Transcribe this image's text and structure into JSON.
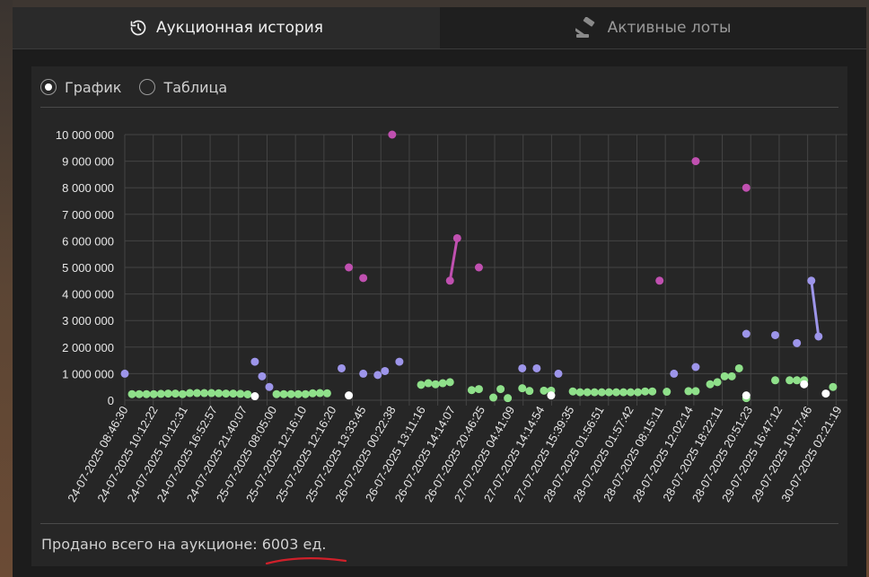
{
  "tabs": {
    "history_label": "Аукционная история",
    "active_lots_label": "Активные лоты"
  },
  "view_switch": {
    "chart_label": "График",
    "table_label": "Таблица",
    "selected": "График"
  },
  "footer": {
    "sold_total_prefix": "Продано всего на аукционе:",
    "sold_total_value": "6003 ед."
  },
  "colors": {
    "green": "#8fe08a",
    "blue": "#9d95ea",
    "magenta": "#c050b0",
    "white": "#ffffff",
    "annotation_red": "#d0202a"
  },
  "chart_data": {
    "type": "scatter",
    "ylim": [
      0,
      10000000
    ],
    "y_ticks": [
      "0",
      "1 000 000",
      "2 000 000",
      "3 000 000",
      "4 000 000",
      "5 000 000",
      "6 000 000",
      "7 000 000",
      "8 000 000",
      "9 000 000",
      "10 000 000"
    ],
    "x_tick_labels": [
      "24-07-2025 08:46:30",
      "24-07-2025 10:12:22",
      "24-07-2025 10:12:31",
      "24-07-2025 16:52:57",
      "24-07-2025 21:40:07",
      "25-07-2025 08:05:00",
      "25-07-2025 12:16:10",
      "25-07-2025 12:16:20",
      "25-07-2025 13:33:45",
      "26-07-2025 00:22:38",
      "26-07-2025 13:11:16",
      "26-07-2025 14:14:07",
      "26-07-2025 20:46:25",
      "27-07-2025 04:41:09",
      "27-07-2025 14:14:54",
      "27-07-2025 15:39:35",
      "28-07-2025 01:56:51",
      "28-07-2025 01:57:42",
      "28-07-2025 08:15:11",
      "28-07-2025 12:02:14",
      "28-07-2025 18:22:11",
      "28-07-2025 20:51:23",
      "29-07-2025 16:47:12",
      "29-07-2025 19:17:46",
      "30-07-2025 02:21:19"
    ],
    "x_range": [
      0,
      100
    ],
    "grid": true,
    "series": [
      {
        "color": "green",
        "points": [
          [
            1,
            230000
          ],
          [
            2,
            230000
          ],
          [
            3,
            230000
          ],
          [
            4,
            230000
          ],
          [
            5,
            240000
          ],
          [
            6,
            250000
          ],
          [
            7,
            250000
          ],
          [
            8,
            230000
          ],
          [
            9,
            270000
          ],
          [
            10,
            270000
          ],
          [
            11,
            270000
          ],
          [
            12,
            270000
          ],
          [
            13,
            260000
          ],
          [
            14,
            250000
          ],
          [
            15,
            250000
          ],
          [
            16,
            240000
          ],
          [
            17,
            220000
          ],
          [
            21,
            230000
          ],
          [
            22,
            230000
          ],
          [
            23,
            230000
          ],
          [
            24,
            230000
          ],
          [
            25,
            230000
          ],
          [
            26,
            260000
          ],
          [
            27,
            270000
          ],
          [
            28,
            260000
          ],
          [
            41,
            580000
          ],
          [
            42,
            640000
          ],
          [
            43,
            600000
          ],
          [
            44,
            640000
          ],
          [
            45,
            680000
          ],
          [
            48,
            380000
          ],
          [
            49,
            420000
          ],
          [
            51,
            100000
          ],
          [
            52,
            420000
          ],
          [
            53,
            80000
          ],
          [
            55,
            450000
          ],
          [
            56,
            350000
          ],
          [
            58,
            360000
          ],
          [
            59,
            360000
          ],
          [
            62,
            330000
          ],
          [
            63,
            300000
          ],
          [
            64,
            300000
          ],
          [
            65,
            300000
          ],
          [
            66,
            300000
          ],
          [
            67,
            300000
          ],
          [
            68,
            300000
          ],
          [
            69,
            300000
          ],
          [
            70,
            300000
          ],
          [
            71,
            300000
          ],
          [
            72,
            330000
          ],
          [
            73,
            330000
          ],
          [
            75,
            320000
          ],
          [
            78,
            340000
          ],
          [
            79,
            340000
          ],
          [
            81,
            600000
          ],
          [
            82,
            680000
          ],
          [
            83,
            900000
          ],
          [
            84,
            900000
          ],
          [
            85,
            1200000
          ],
          [
            86,
            80000
          ],
          [
            90,
            750000
          ],
          [
            92,
            750000
          ],
          [
            93,
            750000
          ],
          [
            94,
            750000
          ],
          [
            98,
            500000
          ]
        ],
        "lines": []
      },
      {
        "color": "blue",
        "points": [
          [
            0,
            1000000
          ],
          [
            18,
            1450000
          ],
          [
            19,
            900000
          ],
          [
            20,
            500000
          ],
          [
            30,
            1200000
          ],
          [
            33,
            1000000
          ],
          [
            35,
            950000
          ],
          [
            36,
            1100000
          ],
          [
            38,
            1450000
          ],
          [
            55,
            1200000
          ],
          [
            57,
            1200000
          ],
          [
            60,
            1000000
          ],
          [
            76,
            1000000
          ],
          [
            79,
            1250000
          ],
          [
            86,
            2500000
          ],
          [
            90,
            2450000
          ],
          [
            93,
            2150000
          ],
          [
            95,
            4500000
          ],
          [
            96,
            2400000
          ]
        ],
        "lines": [
          [
            [
              95,
              4500000
            ],
            [
              96,
              2400000
            ]
          ]
        ]
      },
      {
        "color": "magenta",
        "points": [
          [
            31,
            5000000
          ],
          [
            33,
            4600000
          ],
          [
            37,
            10000000
          ],
          [
            45,
            4500000
          ],
          [
            46,
            6100000
          ],
          [
            49,
            5000000
          ],
          [
            74,
            4500000
          ],
          [
            79,
            9000000
          ],
          [
            86,
            8000000
          ]
        ],
        "lines": [
          [
            [
              45,
              4500000
            ],
            [
              46,
              6100000
            ]
          ]
        ]
      },
      {
        "color": "white",
        "points": [
          [
            18,
            150000
          ],
          [
            31,
            180000
          ],
          [
            59,
            180000
          ],
          [
            86,
            180000
          ],
          [
            94,
            600000
          ],
          [
            97,
            250000
          ]
        ],
        "lines": []
      }
    ]
  }
}
